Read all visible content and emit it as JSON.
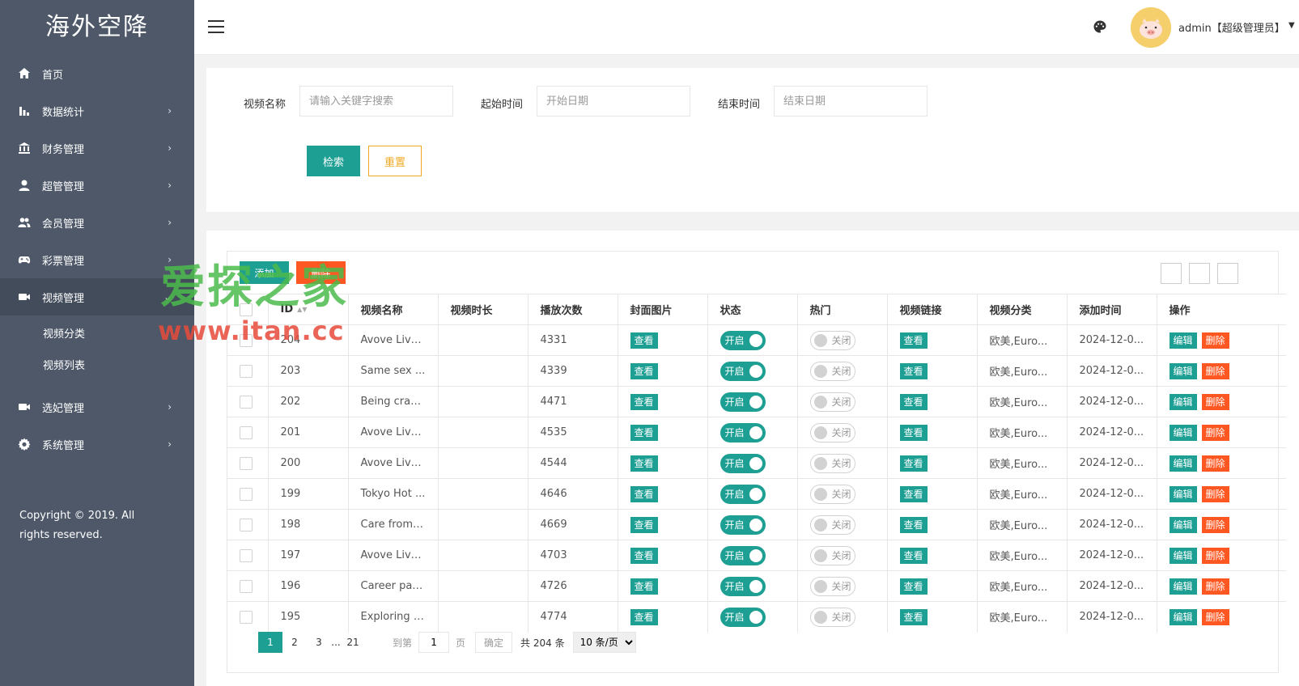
{
  "brand": "海外空降",
  "sidebar": {
    "items": [
      {
        "label": "首页",
        "icon": "home-icon",
        "has_arrow": false
      },
      {
        "label": "数据统计",
        "icon": "bar-chart-icon",
        "has_arrow": true
      },
      {
        "label": "财务管理",
        "icon": "bank-icon",
        "has_arrow": true
      },
      {
        "label": "超管管理",
        "icon": "user-icon",
        "has_arrow": true
      },
      {
        "label": "会员管理",
        "icon": "users-icon",
        "has_arrow": true
      },
      {
        "label": "彩票管理",
        "icon": "gamepad-icon",
        "has_arrow": true
      },
      {
        "label": "视频管理",
        "icon": "video-icon",
        "has_arrow": true,
        "expanded": true
      }
    ],
    "subitems": [
      {
        "label": "视频分类"
      },
      {
        "label": "视频列表"
      }
    ],
    "items_after": [
      {
        "label": "选妃管理",
        "icon": "video-icon",
        "has_arrow": true
      },
      {
        "label": "系统管理",
        "icon": "gear-icon",
        "has_arrow": true
      }
    ],
    "copyright": "Copyright © 2019. All rights reserved."
  },
  "header": {
    "user": "admin【超级管理员】"
  },
  "search": {
    "name_label": "视频名称",
    "name_placeholder": "请输入关键字搜索",
    "start_label": "起始时间",
    "start_placeholder": "开始日期",
    "end_label": "结束时间",
    "end_placeholder": "结束日期",
    "search_button": "检索",
    "reset_button": "重置"
  },
  "toolbar": {
    "add_button": "添加",
    "delete_button": "删除"
  },
  "table": {
    "columns": [
      "ID",
      "视频名称",
      "视频时长",
      "播放次数",
      "封面图片",
      "状态",
      "热门",
      "视频链接",
      "视频分类",
      "添加时间",
      "操作"
    ],
    "view_label": "查看",
    "status_on": "开启",
    "hot_off": "关闭",
    "edit_label": "编辑",
    "delete_label": "删除",
    "rows": [
      {
        "id": "204",
        "name": "Avove Live...",
        "duration": "",
        "plays": "4331",
        "category": "欧美,Euro...",
        "added": "2024-12-0..."
      },
      {
        "id": "203",
        "name": "Same sex ...",
        "duration": "",
        "plays": "4339",
        "category": "欧美,Euro...",
        "added": "2024-12-0..."
      },
      {
        "id": "202",
        "name": "Being craz...",
        "duration": "",
        "plays": "4471",
        "category": "欧美,Euro...",
        "added": "2024-12-0..."
      },
      {
        "id": "201",
        "name": "Avove Live...",
        "duration": "",
        "plays": "4535",
        "category": "欧美,Euro...",
        "added": "2024-12-0..."
      },
      {
        "id": "200",
        "name": "Avove Live...",
        "duration": "",
        "plays": "4544",
        "category": "欧美,Euro...",
        "added": "2024-12-0..."
      },
      {
        "id": "199",
        "name": "Tokyo Hot ...",
        "duration": "",
        "plays": "4646",
        "category": "欧美,Euro...",
        "added": "2024-12-0..."
      },
      {
        "id": "198",
        "name": "Care from ...",
        "duration": "",
        "plays": "4669",
        "category": "欧美,Euro...",
        "added": "2024-12-0..."
      },
      {
        "id": "197",
        "name": "Avove Live...",
        "duration": "",
        "plays": "4703",
        "category": "欧美,Euro...",
        "added": "2024-12-0..."
      },
      {
        "id": "196",
        "name": "Career par...",
        "duration": "",
        "plays": "4726",
        "category": "欧美,Euro...",
        "added": "2024-12-0..."
      },
      {
        "id": "195",
        "name": "Exploring f...",
        "duration": "",
        "plays": "4774",
        "category": "欧美,Euro...",
        "added": "2024-12-0..."
      }
    ]
  },
  "pagination": {
    "pages": [
      "1",
      "2",
      "3"
    ],
    "dots": "...",
    "last_page": "21",
    "goto_label": "到第",
    "goto_value": "1",
    "page_unit": "页",
    "confirm_button": "确定",
    "total": "共 204 条",
    "per_page": "10 条/页"
  },
  "watermark": {
    "title": "爱探之家",
    "url": "www.itan.cc"
  },
  "colors": {
    "sidebar": "#4e5869",
    "primary": "#1e9f94",
    "danger": "#ff5722",
    "warn": "#f0a823"
  }
}
